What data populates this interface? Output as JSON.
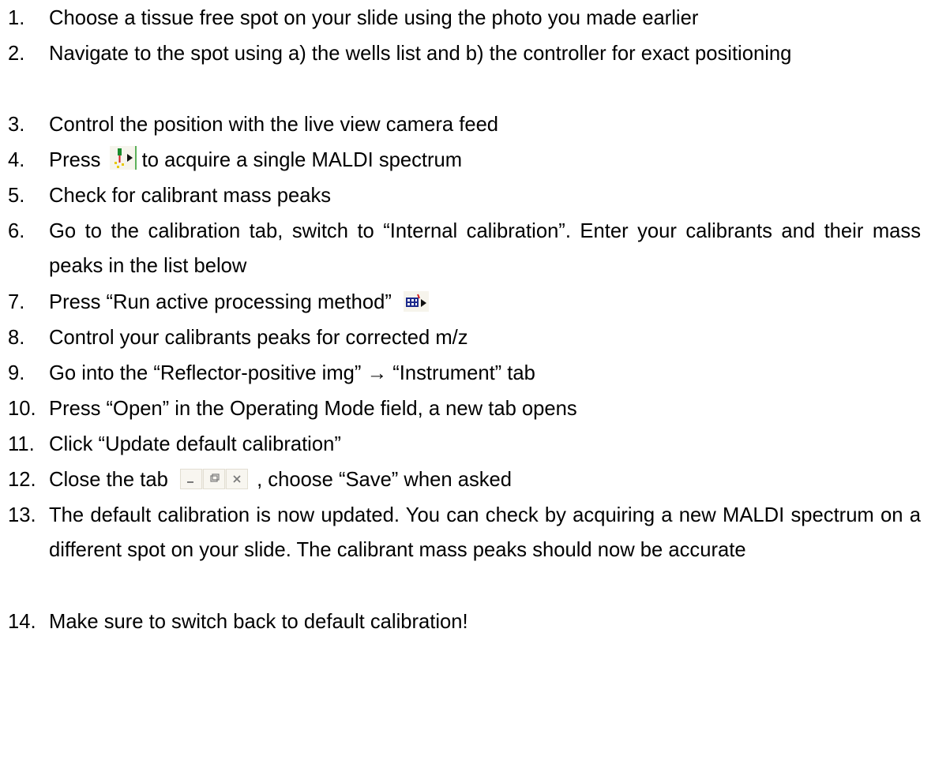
{
  "steps": [
    {
      "n": "1.",
      "parts": [
        "Choose a tissue free spot on your slide using the photo you made earlier"
      ]
    },
    {
      "n": "2.",
      "parts": [
        "Navigate to the spot using a) the wells list and b) the controller for exact positioning"
      ]
    },
    {
      "n": "3.",
      "parts": [
        "Control the position with the live view camera feed"
      ]
    },
    {
      "n": "4.",
      "parts": [
        "Press",
        "to acquire a single MALDI spectrum"
      ],
      "icon": "acquire-spectrum-icon"
    },
    {
      "n": "5.",
      "parts": [
        "Check for calibrant mass peaks"
      ]
    },
    {
      "n": "6.",
      "parts": [
        "Go to the calibration tab, switch to “Internal calibration”. Enter your calibrants and their mass peaks in the list below"
      ]
    },
    {
      "n": "7.",
      "parts": [
        "Press “Run active processing method”"
      ],
      "icon": "run-processing-method-icon"
    },
    {
      "n": "8.",
      "parts": [
        "Control your calibrants peaks for corrected m/z"
      ]
    },
    {
      "n": "9.",
      "parts": [
        "Go into the “Reflector-positive img” → “Instrument” tab"
      ]
    },
    {
      "n": "10.",
      "parts": [
        "Press “Open” in the Operating Mode field, a new tab opens"
      ]
    },
    {
      "n": "11.",
      "parts": [
        "Click “Update default calibration”"
      ]
    },
    {
      "n": "12.",
      "parts": [
        "Close the tab",
        ", choose “Save” when asked"
      ],
      "icon": "window-controls-icon"
    },
    {
      "n": "13.",
      "parts": [
        "The default calibration is now updated. You can check by acquiring a new MALDI spectrum on a different spot on your slide. The calibrant mass peaks should now be accurate"
      ]
    },
    {
      "n": "14.",
      "parts": [
        "Make sure to switch back to default calibration!"
      ]
    }
  ],
  "colors": {
    "text": "#000000",
    "background": "#ffffff",
    "toolbar_bg": "#f4f1ea",
    "icon_green": "#1a8a2a",
    "icon_red": "#d42020",
    "icon_yellow": "#e8c800",
    "icon_navy": "#1c2a8c"
  }
}
